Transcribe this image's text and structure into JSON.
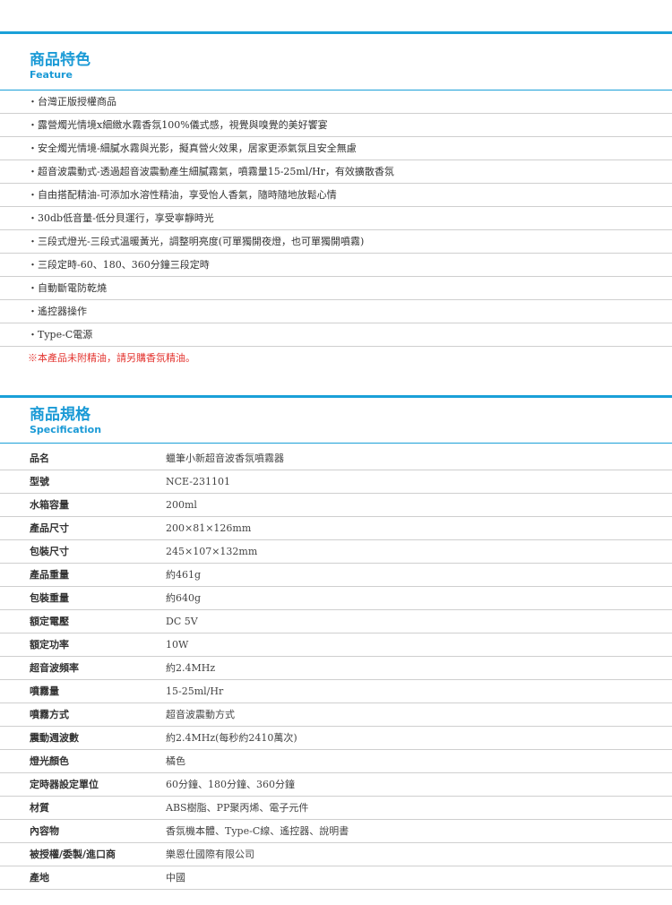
{
  "feature": {
    "title": "商品特色",
    "subtitle": "Feature",
    "items": [
      "・台灣正版授權商品",
      "・露營燭光情境x細緻水霧香氛100%儀式感，視覺與嗅覺的美好饗宴",
      "・安全燭光情境-細膩水霧與光影，擬真營火效果，居家更添氣氛且安全無慮",
      "・超音波震動式-透過超音波震動產生細膩霧氣，噴霧量15-25ml/Hr，有效擴散香氛",
      "・自由搭配精油-可添加水溶性精油，享受怡人香氣，隨時隨地放鬆心情",
      "・30db低音量-低分貝運行，享受寧靜時光",
      "・三段式燈光-三段式溫暖黃光，調整明亮度(可單獨開夜燈，也可單獨開噴霧)",
      "・三段定時-60、180、360分鐘三段定時",
      "・自動斷電防乾燒",
      "・遙控器操作",
      "・Type-C電源"
    ],
    "note": "※本產品未附精油，請另購香氛精油。"
  },
  "spec": {
    "title": "商品規格",
    "subtitle": "Specification",
    "rows": [
      {
        "key": "品名",
        "value": "蠟筆小新超音波香氛噴霧器"
      },
      {
        "key": "型號",
        "value": "NCE-231101"
      },
      {
        "key": "水箱容量",
        "value": "200ml"
      },
      {
        "key": "產品尺寸",
        "value": "200×81×126mm"
      },
      {
        "key": "包裝尺寸",
        "value": "245×107×132mm"
      },
      {
        "key": "產品重量",
        "value": "約461g"
      },
      {
        "key": "包裝重量",
        "value": "約640g"
      },
      {
        "key": "額定電壓",
        "value": "DC 5V"
      },
      {
        "key": "額定功率",
        "value": "10W"
      },
      {
        "key": "超音波頻率",
        "value": "約2.4MHz"
      },
      {
        "key": "噴霧量",
        "value": "15-25ml/Hr"
      },
      {
        "key": "噴霧方式",
        "value": "超音波震動方式"
      },
      {
        "key": "震動週波數",
        "value": "約2.4MHz(每秒約2410萬次)"
      },
      {
        "key": "燈光顏色",
        "value": "橘色"
      },
      {
        "key": "定時器設定單位",
        "value": "60分鐘、180分鐘、360分鐘"
      },
      {
        "key": "材質",
        "value": "ABS樹脂、PP聚丙烯、電子元件"
      },
      {
        "key": "內容物",
        "value": "香氛機本體、Type-C線、遙控器、說明書"
      },
      {
        "key": "被授權/委製/進口商",
        "value": "樂恩仕國際有限公司"
      },
      {
        "key": "產地",
        "value": "中國"
      }
    ]
  },
  "colors": {
    "accent": "#1aa0d8",
    "note": "#e3342f"
  }
}
